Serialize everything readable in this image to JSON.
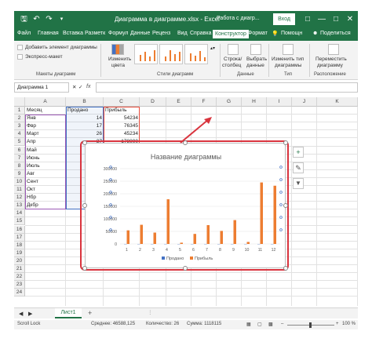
{
  "titlebar": {
    "title": "Диаграмма в диаграмме.xlsx  -  Excel",
    "context": "Работа с диагр...",
    "login": "Вход",
    "save_icon": "save-icon",
    "undo_icon": "undo-icon",
    "redo_icon": "redo-icon"
  },
  "tabs": [
    "Файл",
    "Главная",
    "Вставка",
    "Разметк",
    "Формул",
    "Данные",
    "Реценз",
    "Вид",
    "Справка",
    "Конструктор",
    "Формат"
  ],
  "active_tab": "Конструктор",
  "help_hint": "Помощн",
  "share": "Поделиться",
  "ribbon": {
    "add_element": "Добавить элемент диаграммы",
    "quick_layout": "Экспресс-макет",
    "change_colors_1": "Изменить",
    "change_colors_2": "цвета",
    "row_col_1": "Строка/",
    "row_col_2": "столбец",
    "select_data_1": "Выбрать",
    "select_data_2": "данные",
    "change_type_1": "Изменить тип",
    "change_type_2": "диаграммы",
    "move_chart_1": "Переместить",
    "move_chart_2": "диаграмму",
    "group_layouts": "Макеты диаграмм",
    "group_styles": "Стили диаграмм",
    "group_data": "Данные",
    "group_type": "Тип",
    "group_location": "Расположение"
  },
  "formula_bar": {
    "namebox": "Диаграмма 1",
    "fx": "fx",
    "formula": ""
  },
  "columns": [
    "A",
    "B",
    "C",
    "D",
    "E",
    "F",
    "G",
    "H",
    "I",
    "J",
    "K"
  ],
  "rows": [
    "1",
    "2",
    "3",
    "4",
    "5",
    "6",
    "7",
    "8",
    "9",
    "10",
    "11",
    "12",
    "13",
    "14",
    "15",
    "16",
    "17",
    "18",
    "19",
    "20",
    "21",
    "22",
    "23",
    "24"
  ],
  "table": {
    "header": [
      "Месяц",
      "Продано",
      "Прибыль"
    ],
    "months": [
      "Янв",
      "Фвр",
      "Март",
      "Апр",
      "Май",
      "Июнь",
      "Июль",
      "Авг",
      "Сент",
      "Окт",
      "Нбр",
      "Дкбр"
    ],
    "sold_visible": [
      "14",
      "17",
      "26",
      "37"
    ],
    "profit_visible": [
      "54234",
      "76345",
      "45234",
      "178000"
    ]
  },
  "chart_data": {
    "type": "bar",
    "title": "Название диаграммы",
    "categories": [
      "1",
      "2",
      "3",
      "4",
      "5",
      "6",
      "7",
      "8",
      "9",
      "10",
      "11",
      "12"
    ],
    "series": [
      {
        "name": "Продано",
        "color": "#4472c4",
        "values": [
          14,
          17,
          26,
          37,
          2,
          3,
          4,
          4,
          5,
          6,
          6,
          7
        ]
      },
      {
        "name": "Прибыль",
        "color": "#ed7d31",
        "values": [
          54234,
          76345,
          45234,
          178000,
          5000,
          40000,
          75000,
          52000,
          95000,
          8000,
          245000,
          232000
        ]
      }
    ],
    "ylim": [
      0,
      300000
    ],
    "yticks": [
      "0",
      "50000",
      "100000",
      "150000",
      "200000",
      "250000",
      "300000"
    ],
    "grid": true,
    "legend": "bottom"
  },
  "side_buttons": {
    "add": "+",
    "style": "brush-icon",
    "filter": "filter-icon"
  },
  "sheet": {
    "tab": "Лист1",
    "add": "+"
  },
  "status": {
    "mode": "Scroll Lock",
    "avg": "Среднее: 46588,125",
    "count": "Количество: 26",
    "sum": "Сумма: 1118115",
    "zoom": "100 %"
  }
}
